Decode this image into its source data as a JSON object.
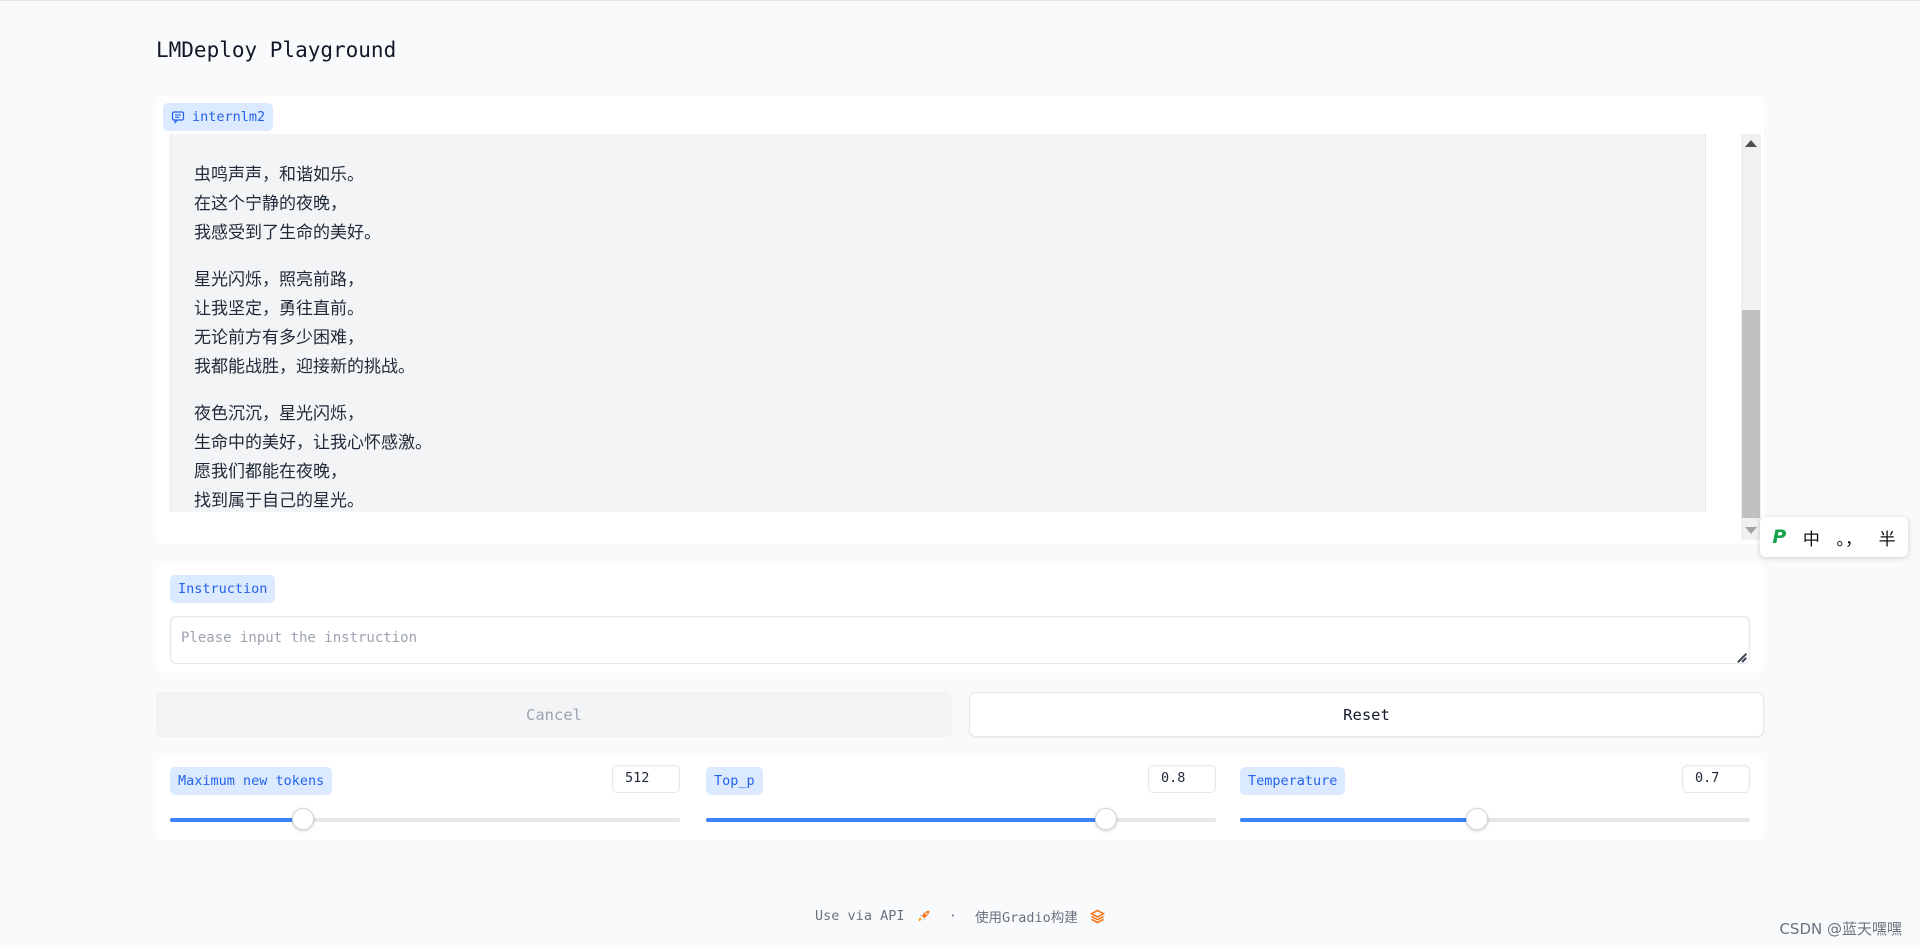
{
  "page": {
    "title": "LMDeploy Playground"
  },
  "chat": {
    "label": "internlm2",
    "paragraphs": [
      [
        "虫鸣声声，和谐如乐。",
        "在这个宁静的夜晚，",
        "我感受到了生命的美好。"
      ],
      [
        "星光闪烁，照亮前路，",
        "让我坚定，勇往直前。",
        "无论前方有多少困难，",
        "我都能战胜，迎接新的挑战。"
      ],
      [
        "夜色沉沉，星光闪烁，",
        "生命中的美好，让我心怀感激。",
        "愿我们都能在夜晚，",
        "找到属于自己的星光。"
      ]
    ]
  },
  "ime": {
    "logo": "P",
    "mode": "中",
    "punct": "。，",
    "width": "半"
  },
  "instruction": {
    "label": "Instruction",
    "placeholder": "Please input the instruction",
    "value": ""
  },
  "buttons": {
    "cancel": "Cancel",
    "reset": "Reset"
  },
  "sliders": [
    {
      "label": "Maximum new tokens",
      "value": "512",
      "fraction": 0.26
    },
    {
      "label": "Top_p",
      "value": "0.8",
      "fraction": 0.785
    },
    {
      "label": "Temperature",
      "value": "0.7",
      "fraction": 0.465
    }
  ],
  "footer": {
    "api": "Use via API",
    "sep": "·",
    "built": "使用Gradio构建"
  },
  "watermark": "CSDN @蓝天嘿嘿",
  "colors": {
    "accent": "#3b82f6",
    "chip_bg": "#dbeafe",
    "chip_text": "#2563eb",
    "gradio_orange": "#f97316"
  }
}
